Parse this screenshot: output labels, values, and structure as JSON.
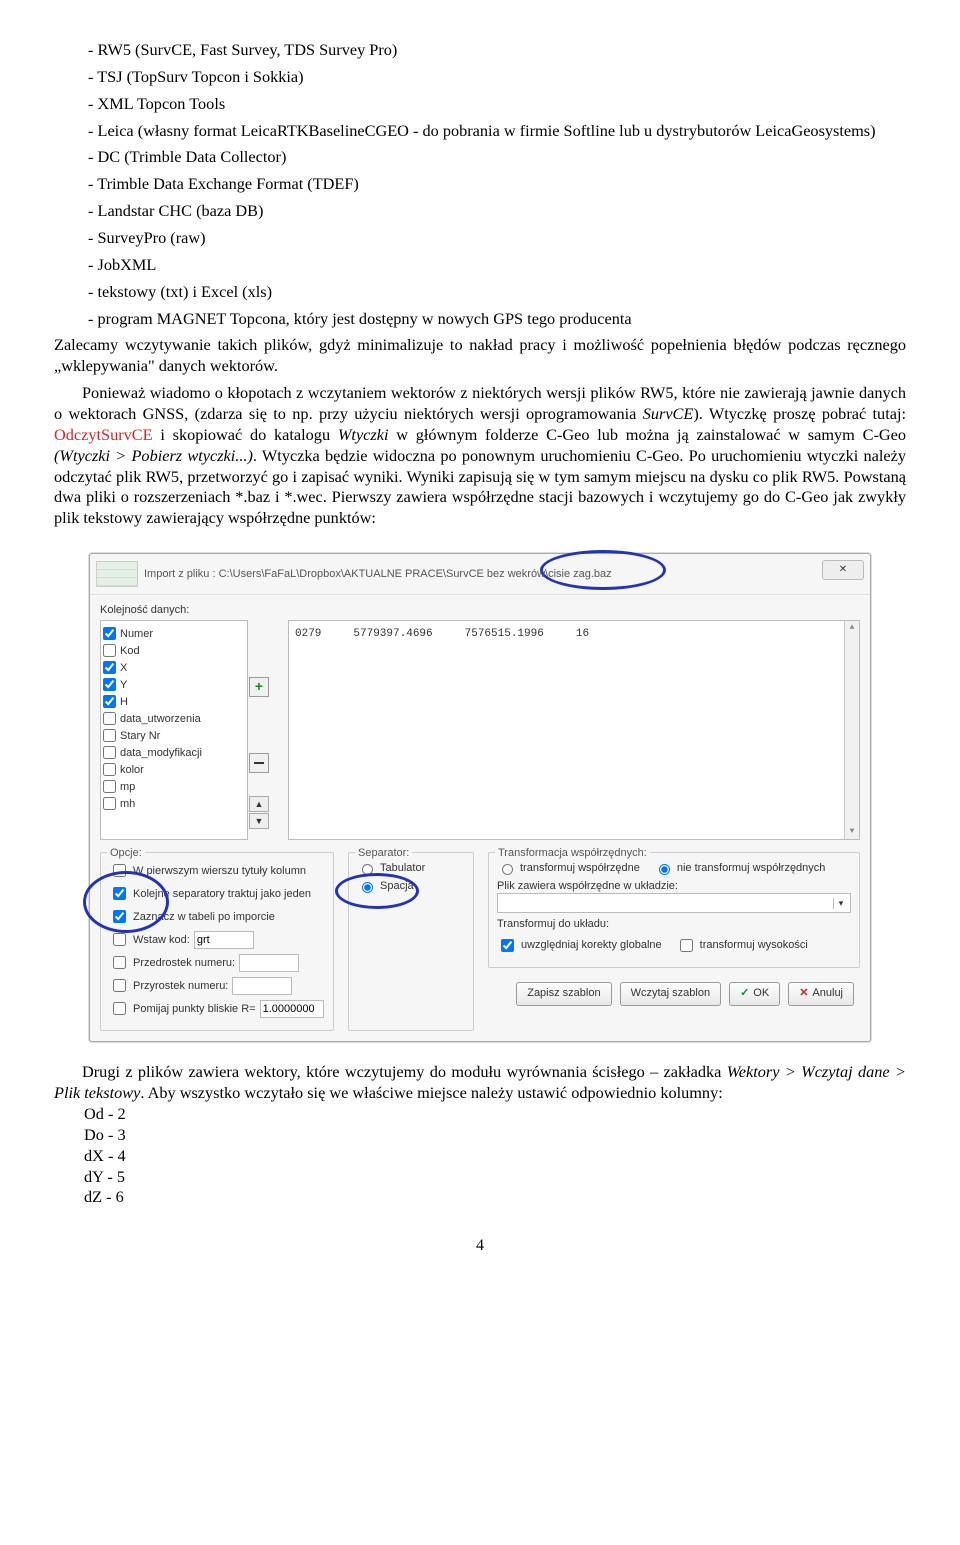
{
  "list": [
    "RW5 (SurvCE, Fast Survey, TDS Survey Pro)",
    "TSJ (TopSurv Topcon i Sokkia)",
    "XML Topcon Tools",
    "Leica (własny format LeicaRTKBaselineCGEO - do pobrania w firmie Softline lub u dystrybutorów LeicaGeosystems)",
    "DC (Trimble Data Collector)",
    "Trimble Data Exchange Format (TDEF)",
    "Landstar CHC (baza DB)",
    "SurveyPro (raw)",
    "JobXML",
    "tekstowy (txt) i Excel (xls)",
    "program MAGNET Topcona, który jest dostępny w nowych GPS tego producenta"
  ],
  "para1": "Zalecamy wczytywanie takich plików, gdyż minimalizuje to nakład pracy i możliwość popełnienia błędów podczas ręcznego „wklepywania\" danych wektorów.",
  "para2a": "Ponieważ wiadomo o kłopotach z wczytaniem wektorów z niektórych wersji plików RW5, które nie zawierają jawnie danych o wektorach GNSS, (zdarza się to np. przy użyciu niektórych wersji oprogramowania ",
  "para2em1": "SurvCE",
  "para2b": "). Wtyczkę proszę pobrać tutaj: ",
  "para2link": "OdczytSurvCE",
  "para2c": " i skopiować do katalogu ",
  "para2em2": "Wtyczki",
  "para2d": " w głównym folderze C-Geo lub można ją zainstalować w samym C-Geo ",
  "para2em3": "(Wtyczki > Pobierz wtyczki...)",
  "para2e": ". Wtyczka będzie widoczna po ponownym uruchomieniu C-Geo. Po uruchomieniu wtyczki należy odczytać plik RW5, przetworzyć go i zapisać wyniki. Wyniki zapisują się w tym samym miejscu na dysku co plik RW5. Powstaną dwa pliki o rozszerzeniach *.baz i *.wec. Pierwszy zawiera współrzędne stacji bazowych i wczytujemy go do C-Geo jak zwykły plik tekstowy zawierający współrzędne punktów:",
  "dlg": {
    "title_a": "Import z pliku : C:\\Users\\FaFaL\\Dropbox\\AKTUALNE PRACE\\SurvCE bez wek",
    "title_b": "rów\\cisie zag.baz",
    "close": "✕",
    "kolejnosc_label": "Kolejność danych:",
    "cols": [
      {
        "label": "Numer",
        "on": true
      },
      {
        "label": "Kod",
        "on": false
      },
      {
        "label": "X",
        "on": true
      },
      {
        "label": "Y",
        "on": true
      },
      {
        "label": "H",
        "on": true
      },
      {
        "label": "data_utworzenia",
        "on": false
      },
      {
        "label": "Stary Nr",
        "on": false
      },
      {
        "label": "data_modyfikacji",
        "on": false
      },
      {
        "label": "kolor",
        "on": false
      },
      {
        "label": "mp",
        "on": false
      },
      {
        "label": "mh",
        "on": false
      }
    ],
    "preview": {
      "c1": "0279",
      "c2": "5779397.4696",
      "c3": "7576515.1996",
      "c4": "16"
    },
    "opcje": {
      "legend": "Opcje:",
      "o1": "W pierwszym wierszu tytuły kolumn",
      "o2": "Kolejne separatory traktuj jako jeden",
      "o3": "Zaznacz w tabeli po imporcie",
      "o4": "Wstaw kod:",
      "o4v": "grt",
      "o5": "Przedrostek numeru:",
      "o6": "Przyrostek numeru:",
      "o7": "Pomijaj punkty bliskie R=",
      "o7v": "1.0000000"
    },
    "sep": {
      "legend": "Separator:",
      "r1": "Tabulator",
      "r2": "Spacja"
    },
    "transf": {
      "legend": "Transformacja współrzędnych:",
      "r1": "transformuj współrzędne",
      "r2": "nie transformuj współrzędnych",
      "l1": "Plik zawiera współrzędne w układzie:",
      "l2": "Transformuj do układu:",
      "c1": "uwzględniaj korekty globalne",
      "c2": "transformuj wysokości"
    },
    "btns": {
      "save": "Zapisz szablon",
      "load": "Wczytaj szablon",
      "ok": "OK",
      "cancel": "Anuluj"
    }
  },
  "para3a": "Drugi z plików zawiera wektory, które wczytujemy do modułu wyrównania ścisłego – zakładka ",
  "para3em": "Wektory > Wczytaj dane > Plik tekstowy",
  "para3b": ". Aby wszystko wczytało się we właściwe miejsce należy ustawić odpowiednio kolumny:",
  "colmap": [
    "Od - 2",
    "Do - 3",
    "dX - 4",
    "dY - 5",
    "dZ - 6"
  ],
  "page": "4"
}
